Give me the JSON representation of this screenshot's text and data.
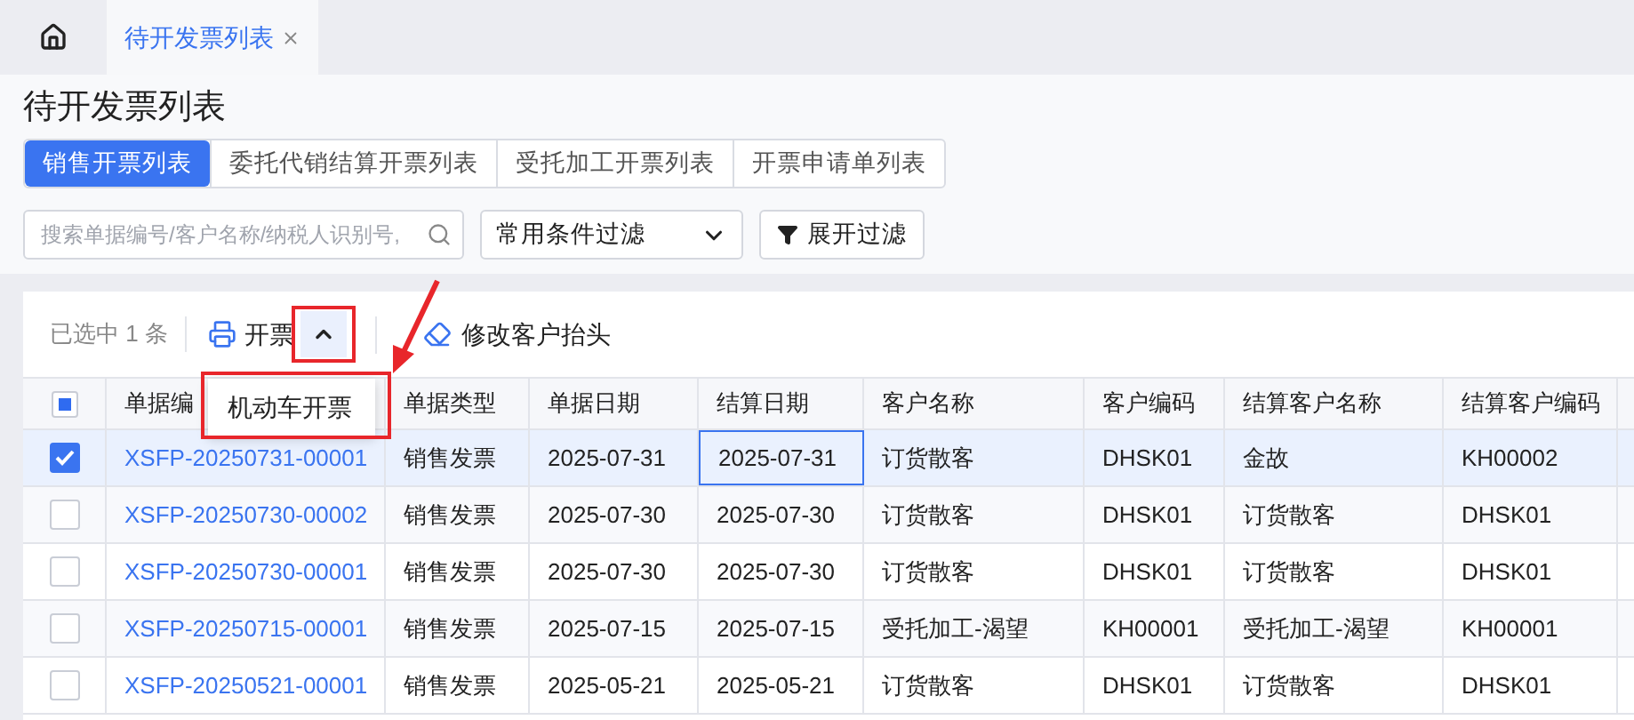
{
  "nav_tabs": [
    {
      "label": "待开发票列表",
      "selected": true
    }
  ],
  "page_title": "待开发票列表",
  "list_tabs": [
    {
      "label": "销售开票列表",
      "selected": true
    },
    {
      "label": "委托代销结算开票列表",
      "selected": false
    },
    {
      "label": "受托加工开票列表",
      "selected": false
    },
    {
      "label": "开票申请单列表",
      "selected": false
    }
  ],
  "search": {
    "placeholder": "搜索单据编号/客户名称/纳税人识别号,"
  },
  "filter_select": {
    "value": "常用条件过滤"
  },
  "expand_filter_button": "展开过滤",
  "toolbar": {
    "selection_count": "已选中 1 条",
    "invoice_button": "开票",
    "invoice_menu_expanded": true,
    "menu_items": [
      "机动车开票"
    ],
    "edit_header_button": "修改客户抬头"
  },
  "table": {
    "header_checkbox": {
      "indeterminate": true
    },
    "columns": [
      "单据编",
      "单据类型",
      "单据日期",
      "结算日期",
      "客户名称",
      "客户编码",
      "结算客户名称",
      "结算客户编码"
    ],
    "rows": [
      {
        "selected": true,
        "focused_cell": true,
        "number": "XSFP-20250731-00001",
        "type": "销售发票",
        "date": "2025-07-31",
        "settle_date": "2025-07-31",
        "customer": "订货散客",
        "customer_code": "DHSK01",
        "settle_customer": "金故",
        "settle_customer_code": "KH00002"
      },
      {
        "selected": false,
        "focused_cell": false,
        "number": "XSFP-20250730-00002",
        "type": "销售发票",
        "date": "2025-07-30",
        "settle_date": "2025-07-30",
        "customer": "订货散客",
        "customer_code": "DHSK01",
        "settle_customer": "订货散客",
        "settle_customer_code": "DHSK01"
      },
      {
        "selected": false,
        "focused_cell": false,
        "number": "XSFP-20250730-00001",
        "type": "销售发票",
        "date": "2025-07-30",
        "settle_date": "2025-07-30",
        "customer": "订货散客",
        "customer_code": "DHSK01",
        "settle_customer": "订货散客",
        "settle_customer_code": "DHSK01"
      },
      {
        "selected": false,
        "focused_cell": false,
        "number": "XSFP-20250715-00001",
        "type": "销售发票",
        "date": "2025-07-15",
        "settle_date": "2025-07-15",
        "customer": "受托加工-渴望",
        "customer_code": "KH00001",
        "settle_customer": "受托加工-渴望",
        "settle_customer_code": "KH00001"
      },
      {
        "selected": false,
        "focused_cell": false,
        "number": "XSFP-20250521-00001",
        "type": "销售发票",
        "date": "2025-05-21",
        "settle_date": "2025-05-21",
        "customer": "订货散客",
        "customer_code": "DHSK01",
        "settle_customer": "订货散客",
        "settle_customer_code": "DHSK01"
      }
    ]
  }
}
